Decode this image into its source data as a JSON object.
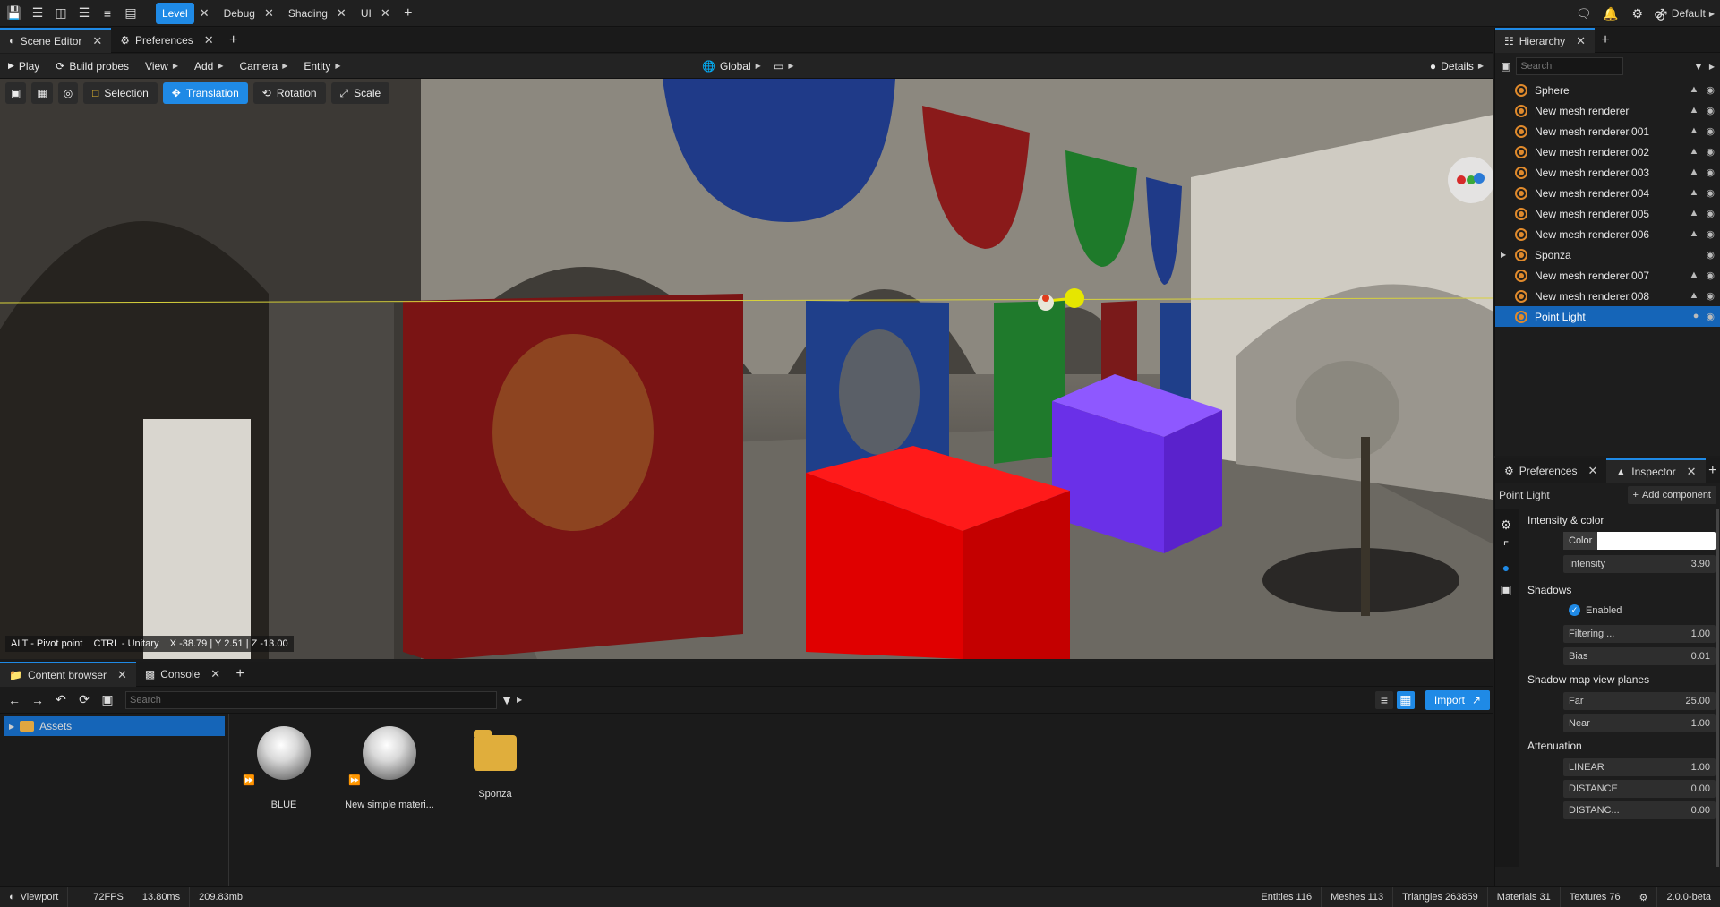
{
  "topbar": {
    "tabs": [
      {
        "label": "Level",
        "active": true
      },
      {
        "label": "Debug",
        "active": false
      },
      {
        "label": "Shading",
        "active": false
      },
      {
        "label": "UI",
        "active": false
      }
    ],
    "profile_label": "Default"
  },
  "scene_editor": {
    "tabs": [
      {
        "label": "Scene Editor",
        "active": true
      },
      {
        "label": "Preferences",
        "active": false
      }
    ],
    "toolbar": {
      "play_label": "Play",
      "build_probes_label": "Build probes",
      "view_label": "View",
      "add_label": "Add",
      "camera_label": "Camera",
      "entity_label": "Entity",
      "global_label": "Global",
      "details_label": "Details"
    },
    "gizmo_buttons": [
      {
        "label": "Selection",
        "active": false
      },
      {
        "label": "Translation",
        "active": true
      },
      {
        "label": "Rotation",
        "active": false
      },
      {
        "label": "Scale",
        "active": false
      }
    ],
    "viewport_info": "ALT - Pivot point    CTRL - Unitary    X -38.79 | Y 2.51 | Z -13.00"
  },
  "hierarchy": {
    "title": "Hierarchy",
    "search_placeholder": "Search",
    "items": [
      {
        "label": "Sphere",
        "selected": false
      },
      {
        "label": "New mesh renderer",
        "selected": false
      },
      {
        "label": "New mesh renderer.001",
        "selected": false
      },
      {
        "label": "New mesh renderer.002",
        "selected": false
      },
      {
        "label": "New mesh renderer.003",
        "selected": false
      },
      {
        "label": "New mesh renderer.004",
        "selected": false
      },
      {
        "label": "New mesh renderer.005",
        "selected": false
      },
      {
        "label": "New mesh renderer.006",
        "selected": false
      },
      {
        "label": "Sponza",
        "selected": false
      },
      {
        "label": "New mesh renderer.007",
        "selected": false
      },
      {
        "label": "New mesh renderer.008",
        "selected": false
      },
      {
        "label": "Point Light",
        "selected": true
      }
    ]
  },
  "inspector": {
    "tabs": [
      {
        "label": "Preferences",
        "active": false
      },
      {
        "label": "Inspector",
        "active": true
      }
    ],
    "entity_name": "Point Light",
    "add_component_label": "Add component",
    "sections": {
      "intensity_color": "Intensity & color",
      "shadows": "Shadows",
      "shadow_map": "Shadow map view planes",
      "attenuation": "Attenuation"
    },
    "fields": {
      "color_label": "Color",
      "color_value": "#ffffff",
      "intensity_label": "Intensity",
      "intensity_value": "3.90",
      "enabled_label": "Enabled",
      "filtering_label": "Filtering ...",
      "filtering_value": "1.00",
      "bias_label": "Bias",
      "bias_value": "0.01",
      "far_label": "Far",
      "far_value": "25.00",
      "near_label": "Near",
      "near_value": "1.00",
      "linear_label": "LINEAR",
      "linear_value": "1.00",
      "distance_label": "DISTANCE",
      "distance_value": "0.00",
      "distance2_label": "DISTANC...",
      "distance2_value": "0.00"
    }
  },
  "content_browser": {
    "tabs": [
      {
        "label": "Content browser",
        "active": true
      },
      {
        "label": "Console",
        "active": false
      }
    ],
    "search_placeholder": "Search",
    "import_label": "Import",
    "tree_root": "Assets",
    "assets": [
      {
        "label": "BLUE",
        "kind": "material"
      },
      {
        "label": "New simple materi...",
        "kind": "material"
      },
      {
        "label": "Sponza",
        "kind": "folder"
      }
    ]
  },
  "statusbar": {
    "viewport_label": "Viewport",
    "fps": "72FPS",
    "frame_time": "13.80ms",
    "memory": "209.83mb",
    "entities": "Entities 116",
    "meshes": "Meshes 113",
    "triangles": "Triangles 263859",
    "materials": "Materials 31",
    "textures": "Textures 76",
    "version": "2.0.0-beta"
  },
  "colors": {
    "accent": "#1f8ae6",
    "selection": "#1565b8",
    "red_cube": "#e00000",
    "purple_cube": "#7a3cf0",
    "light_gizmo": "#e6e600"
  }
}
